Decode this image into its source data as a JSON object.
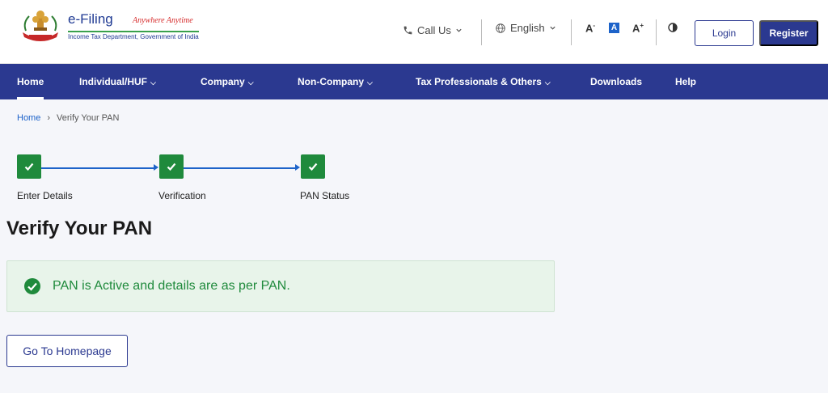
{
  "header": {
    "logo": {
      "title": "e-Filing",
      "tagline": "Anywhere Anytime",
      "subtitle": "Income Tax Department, Government of India",
      "emblem_icon": "national-emblem-icon"
    },
    "call_label": "Call Us",
    "language_label": "English",
    "font_decrease": "A",
    "font_default": "A",
    "font_increase": "A",
    "login_label": "Login",
    "register_label": "Register"
  },
  "nav": {
    "items": [
      {
        "label": "Home",
        "active": true
      },
      {
        "label": "Individual/HUF",
        "dropdown": true
      },
      {
        "label": "Company",
        "dropdown": true
      },
      {
        "label": "Non-Company",
        "dropdown": true
      },
      {
        "label": "Tax Professionals & Others",
        "dropdown": true
      },
      {
        "label": "Downloads"
      },
      {
        "label": "Help"
      }
    ]
  },
  "breadcrumb": {
    "home": "Home",
    "separator": "›",
    "current": "Verify Your PAN"
  },
  "steps": [
    {
      "label": "Enter Details",
      "status": "complete"
    },
    {
      "label": "Verification",
      "status": "complete"
    },
    {
      "label": "PAN Status",
      "status": "complete"
    }
  ],
  "page_title": "Verify Your PAN",
  "alert": {
    "message": "PAN is Active and details are as per PAN."
  },
  "go_home_label": "Go To Homepage",
  "colors": {
    "brand_blue": "#2b3990",
    "link_blue": "#1d63c9",
    "success_green": "#1f8a3c",
    "alert_bg": "#e8f4ea",
    "page_bg": "#f5f6fa"
  }
}
